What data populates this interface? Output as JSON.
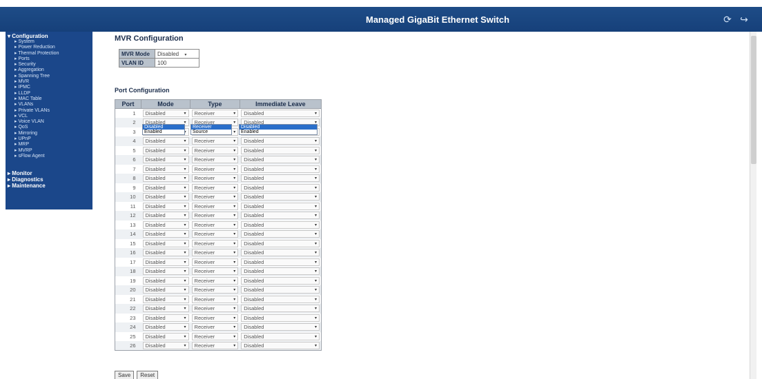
{
  "header": {
    "title": "Managed GigaBit Ethernet Switch",
    "icons": [
      "refresh-icon",
      "logout-icon"
    ]
  },
  "sidebar": {
    "configuration": "▾ Configuration",
    "items": [
      "▸ System",
      "▸ Power Reduction",
      "▸ Thermal Protection",
      "▸ Ports",
      "▸ Security",
      "▸ Aggregation",
      "▸ Spanning Tree",
      "▸ MVR",
      "▸ IPMC",
      "▸ LLDP",
      "▸ MAC Table",
      "▸ VLANs",
      "▸ Private VLANs",
      "▸ VCL",
      "▸ Voice VLAN",
      "▸ QoS",
      "▸ Mirroring",
      "▸ UPnP",
      "▸ MRP",
      "▸ MVRP",
      "▸ sFlow Agent"
    ],
    "monitor": "▸ Monitor",
    "diagnostics": "▸ Diagnostics",
    "maintenance": "▸ Maintenance"
  },
  "mvr": {
    "title": "MVR Configuration",
    "mode_label": "MVR Mode",
    "mode_value": "Disabled",
    "vlan_label": "VLAN ID",
    "vlan_value": "100"
  },
  "ports": {
    "title": "Port Configuration",
    "headers": [
      "Port",
      "Mode",
      "Type",
      "Immediate Leave"
    ],
    "rows": [
      {
        "port": "1",
        "mode": "Disabled",
        "type": "Receiver",
        "leave": "Disabled"
      },
      {
        "port": "2",
        "mode": "Disabled",
        "type": "Receiver",
        "leave": "Disabled"
      },
      {
        "port": "3",
        "mode": "Disabled",
        "type": "Receiver",
        "leave": "Disabled"
      },
      {
        "port": "4",
        "mode": "Disabled",
        "type": "Receiver",
        "leave": "Disabled"
      },
      {
        "port": "5",
        "mode": "Disabled",
        "type": "Receiver",
        "leave": "Disabled"
      },
      {
        "port": "6",
        "mode": "Disabled",
        "type": "Receiver",
        "leave": "Disabled"
      },
      {
        "port": "7",
        "mode": "Disabled",
        "type": "Receiver",
        "leave": "Disabled"
      },
      {
        "port": "8",
        "mode": "Disabled",
        "type": "Receiver",
        "leave": "Disabled"
      },
      {
        "port": "9",
        "mode": "Disabled",
        "type": "Receiver",
        "leave": "Disabled"
      },
      {
        "port": "10",
        "mode": "Disabled",
        "type": "Receiver",
        "leave": "Disabled"
      },
      {
        "port": "11",
        "mode": "Disabled",
        "type": "Receiver",
        "leave": "Disabled"
      },
      {
        "port": "12",
        "mode": "Disabled",
        "type": "Receiver",
        "leave": "Disabled"
      },
      {
        "port": "13",
        "mode": "Disabled",
        "type": "Receiver",
        "leave": "Disabled"
      },
      {
        "port": "14",
        "mode": "Disabled",
        "type": "Receiver",
        "leave": "Disabled"
      },
      {
        "port": "15",
        "mode": "Disabled",
        "type": "Receiver",
        "leave": "Disabled"
      },
      {
        "port": "16",
        "mode": "Disabled",
        "type": "Receiver",
        "leave": "Disabled"
      },
      {
        "port": "17",
        "mode": "Disabled",
        "type": "Receiver",
        "leave": "Disabled"
      },
      {
        "port": "18",
        "mode": "Disabled",
        "type": "Receiver",
        "leave": "Disabled"
      },
      {
        "port": "19",
        "mode": "Disabled",
        "type": "Receiver",
        "leave": "Disabled"
      },
      {
        "port": "20",
        "mode": "Disabled",
        "type": "Receiver",
        "leave": "Disabled"
      },
      {
        "port": "21",
        "mode": "Disabled",
        "type": "Receiver",
        "leave": "Disabled"
      },
      {
        "port": "22",
        "mode": "Disabled",
        "type": "Receiver",
        "leave": "Disabled"
      },
      {
        "port": "23",
        "mode": "Disabled",
        "type": "Receiver",
        "leave": "Disabled"
      },
      {
        "port": "24",
        "mode": "Disabled",
        "type": "Receiver",
        "leave": "Disabled"
      },
      {
        "port": "25",
        "mode": "Disabled",
        "type": "Receiver",
        "leave": "Disabled"
      },
      {
        "port": "26",
        "mode": "Disabled",
        "type": "Receiver",
        "leave": "Disabled"
      }
    ]
  },
  "dropdowns": {
    "mode_options": [
      "Disabled",
      "Enabled"
    ],
    "type_options": [
      "Receiver",
      "Source"
    ],
    "leave_options": [
      "Disabled",
      "Enabled"
    ]
  },
  "buttons": {
    "save": "Save",
    "reset": "Reset"
  },
  "colors": {
    "header_bg": "#1e4c87",
    "sidebar_bg": "#1b478a",
    "table_header_bg": "#b9c2cc",
    "highlight": "#2a6ec9"
  }
}
